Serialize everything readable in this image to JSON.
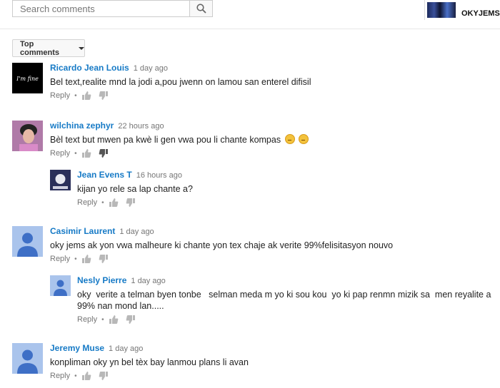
{
  "search": {
    "placeholder": "Search comments"
  },
  "channel": {
    "name": "OKYJEMS N"
  },
  "sort": {
    "label": "Top comments"
  },
  "comments": [
    {
      "author": "Ricardo Jean Louis",
      "time": "1 day ago",
      "text": "Bel text,realite mnd la jodi a,pou jwenn on lamou san enterel difisil",
      "reply_label": "Reply",
      "avatar_text": "I'm fine"
    },
    {
      "author": "wilchina zephyr",
      "time": "22 hours ago",
      "text": "Bèl text but mwen pa kwè li gen vwa pou li chante kompas",
      "reply_label": "Reply"
    },
    {
      "author": "Jean Evens T",
      "time": "16 hours ago",
      "text": "kijan yo rele sa lap chante a?",
      "reply_label": "Reply"
    },
    {
      "author": "Casimir Laurent",
      "time": "1 day ago",
      "text": "oky jems ak yon vwa malheure ki chante yon tex chaje ak verite 99%felisitasyon nouvo",
      "reply_label": "Reply"
    },
    {
      "author": "Nesly Pierre",
      "time": "1 day ago",
      "text": "oky  verite a telman byen tonbe   selman meda m yo ki sou kou  yo ki pap renmn mizik sa  men reyalite a 99% nan mond lan.....",
      "reply_label": "Reply"
    },
    {
      "author": "Jeremy Muse",
      "time": "1 day ago",
      "text": "konpliman oky  yn bel tèx bay lanmou plans li avan",
      "reply_label": "Reply"
    }
  ]
}
